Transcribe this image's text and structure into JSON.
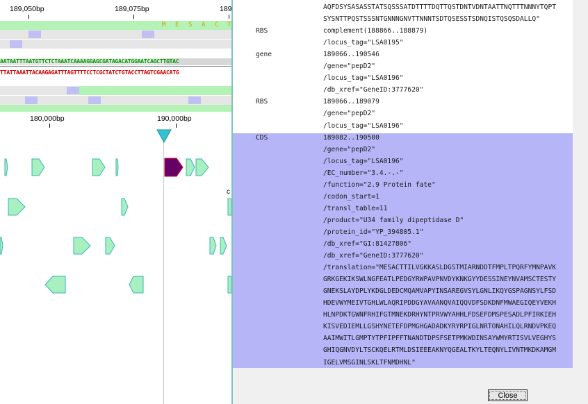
{
  "ruler_top": {
    "labels": [
      "189,050bp",
      "189,075bp",
      "189"
    ]
  },
  "translation_track": {
    "letters": [
      "M",
      "E",
      "S",
      "A",
      "C",
      "T"
    ]
  },
  "sequence": {
    "forward": "AATAATTTAATGTTCTCTAAATCAAAAGGAGCGATAGACATGGAATCAGCTTGTAC",
    "reverse": "TTATTAAATTACAAGAGATTTAGTTTTCCTCGCTATCTGTACCTTAGTCGAACATG"
  },
  "ruler_bottom": {
    "labels": [
      "180,000bp",
      "190,000bp"
    ]
  },
  "colors": {
    "track_green": "#b5f2b5",
    "track_grey": "#e6e6e6",
    "track_blue": "#c0c0f5",
    "feature_fill": "#a8f0c0",
    "feature_stroke": "#39b5b5",
    "selected_feature": "#660066",
    "cursor_marker": "#33c3d7",
    "selection_highlight": "#b5b5f7",
    "divider": "#7fc4c0"
  },
  "genbank_entry": {
    "rows": [
      {
        "key": "",
        "value": "AQFDSYSASASSTATSQSSSATDTTTTDQTTQSTDNTVDNTAATTNQTTTNNNYTQPT"
      },
      {
        "key": "",
        "value": "SYSNTTPQSTSSSNTGNNNGNVTTNNNTSDTQSESSTSDNQISTQSQSDALLQ\""
      },
      {
        "key": "RBS",
        "value": "complement(188866..188879)"
      },
      {
        "key": "",
        "value": "/locus_tag=\"LSA0195\""
      },
      {
        "key": "gene",
        "value": "189066..190546"
      },
      {
        "key": "",
        "value": "/gene=\"pepD2\""
      },
      {
        "key": "",
        "value": "/locus_tag=\"LSA0196\""
      },
      {
        "key": "",
        "value": "/db_xref=\"GeneID:3777620\""
      },
      {
        "key": "RBS",
        "value": "189066..189079"
      },
      {
        "key": "",
        "value": "/gene=\"pepD2\""
      },
      {
        "key": "",
        "value": "/locus_tag=\"LSA0196\""
      },
      {
        "key": "CDS",
        "value": "189082..190500"
      },
      {
        "key": "",
        "value": "/gene=\"pepD2\""
      },
      {
        "key": "",
        "value": "/locus_tag=\"LSA0196\""
      },
      {
        "key": "",
        "value": "/EC_number=\"3.4.-.-\""
      },
      {
        "key": "",
        "value": "/function=\"2.9 Protein fate\""
      },
      {
        "key": "",
        "value": "/codon_start=1"
      },
      {
        "key": "",
        "value": "/transl_table=11"
      },
      {
        "key": "",
        "value": "/product=\"U34 family dipeptidase D\""
      },
      {
        "key": "",
        "value": "/protein_id=\"YP_394805.1\""
      },
      {
        "key": "",
        "value": "/db_xref=\"GI:81427806\""
      },
      {
        "key": "",
        "value": "/db_xref=\"GeneID:3777620\""
      },
      {
        "key": "",
        "value": "/translation=\"MESACTTILVGKKASLDGSTMIARNDDTFMPLTPQRFYMNPAVK"
      },
      {
        "key": "",
        "value": "GRKGEKIKSWLNGFEATLPEDGYRWPAVPNVDYKNKGYYDESSINEYNVAMSCTESTY"
      },
      {
        "key": "",
        "value": "GNEKSLAYDPLYKDGLDEDCMQAMVAPYINSAREGVSYLGNLIKQYGSPAGNSYLFSD"
      },
      {
        "key": "",
        "value": "HDEVWYMEIVTGHLWLAQRIPDDGYAVAANQVAIQQVDFSDKDNFMWAEGIQEYVEKH"
      },
      {
        "key": "",
        "value": "HLNPDKTGWNFRHIFGTMNEKDRHYNTPRVWYAHHLFDSEFDMSPESADLPFIRKIEH"
      },
      {
        "key": "",
        "value": "KISVEDIEMLLGSHYNETEFDPMGHGADADKYRYRPIGLNRTONAHILQLRNDVPKEQ"
      },
      {
        "key": "",
        "value": "AAIMWITLGMPTYTPFIPFFTNANDTDPSFSETPMKWDINSAYWMYRTISVLVEGHYS"
      },
      {
        "key": "",
        "value": "GHIQGNVDYLTSCKQELRTMLDSIEEEAKNYQGEALTKYLTEQNYLIVNTMKDKAMGM"
      },
      {
        "key": "",
        "value": "IGELVMSGINLSKLTFNMDHNL\""
      }
    ]
  },
  "close_button": {
    "label": "Close"
  }
}
